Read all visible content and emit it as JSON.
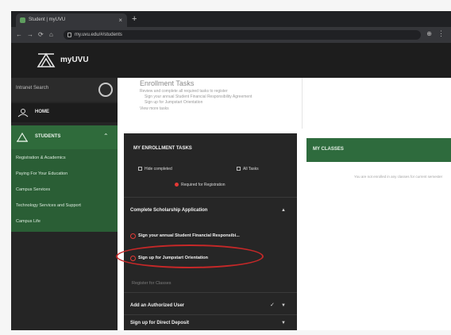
{
  "browser": {
    "tab_title": "Student | myUVU",
    "url": "my.uvu.edu/#/students"
  },
  "site": {
    "logo_text": "myUVU"
  },
  "sidebar": {
    "search_label": "Intranet Search",
    "home_label": "HOME",
    "students_label": "STUDENTS",
    "sub_items": [
      "Registration & Academics",
      "Paying For Your Education",
      "Campus Services",
      "Technology Services and Support",
      "Campus Life"
    ]
  },
  "main": {
    "enrollment_title": "Enrollment Tasks",
    "enrollment_lines": [
      "Review and complete all required tasks to register",
      "Sign your annual Student Financial Responsibility Agreement",
      "Sign up for Jumpstart Orientation",
      "View more tasks"
    ]
  },
  "tasks": {
    "title": "MY ENROLLMENT TASKS",
    "filter_1": "Hide completed",
    "filter_2": "All Tasks",
    "filter_3": "Required for Registration",
    "section_1": "Complete Scholarship Application",
    "todo_1": "Sign your annual Student Financial Responsibi...",
    "todo_2": "Sign up for Jumpstart Orientation",
    "register_link": "Register for Classes",
    "section_2": "Add an Authorized User",
    "section_3": "Sign up for Direct Deposit"
  },
  "classes": {
    "title": "MY CLASSES",
    "empty_message": "You are not enrolled in any classes for current semester"
  },
  "colors": {
    "accent_green": "#2e6b3d",
    "alert_red": "#e53935",
    "panel_dark": "#262626"
  }
}
